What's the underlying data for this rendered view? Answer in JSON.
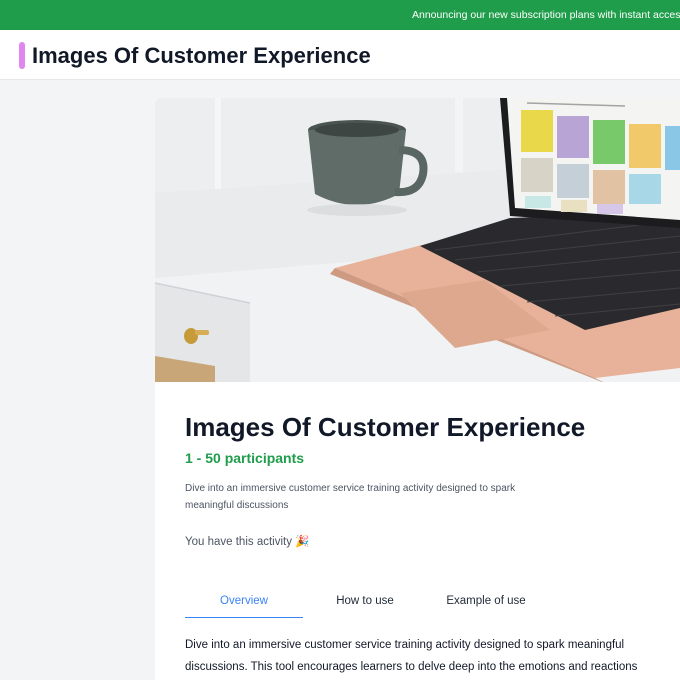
{
  "banner": {
    "text": "Announcing our new subscription plans with instant access"
  },
  "header": {
    "title": "Images Of Customer Experience"
  },
  "activity": {
    "title": "Images Of Customer Experience",
    "participants": "1 - 50 participants",
    "short_description": "Dive into an immersive customer service training activity designed to spark meaningful discussions",
    "owned_status": "You have this activity 🎉"
  },
  "tabs": [
    {
      "label": "Overview",
      "active": true
    },
    {
      "label": "How to use",
      "active": false
    },
    {
      "label": "Example of use",
      "active": false
    }
  ],
  "overview": {
    "text": "Dive into an immersive customer service training activity designed to spark meaningful discussions. This tool encourages learners to delve deep into the emotions and reactions"
  },
  "colors": {
    "banner": "#1f9d4b",
    "accent": "#e086f0",
    "participants": "#1f9d4b",
    "active_tab": "#3b82f6"
  }
}
